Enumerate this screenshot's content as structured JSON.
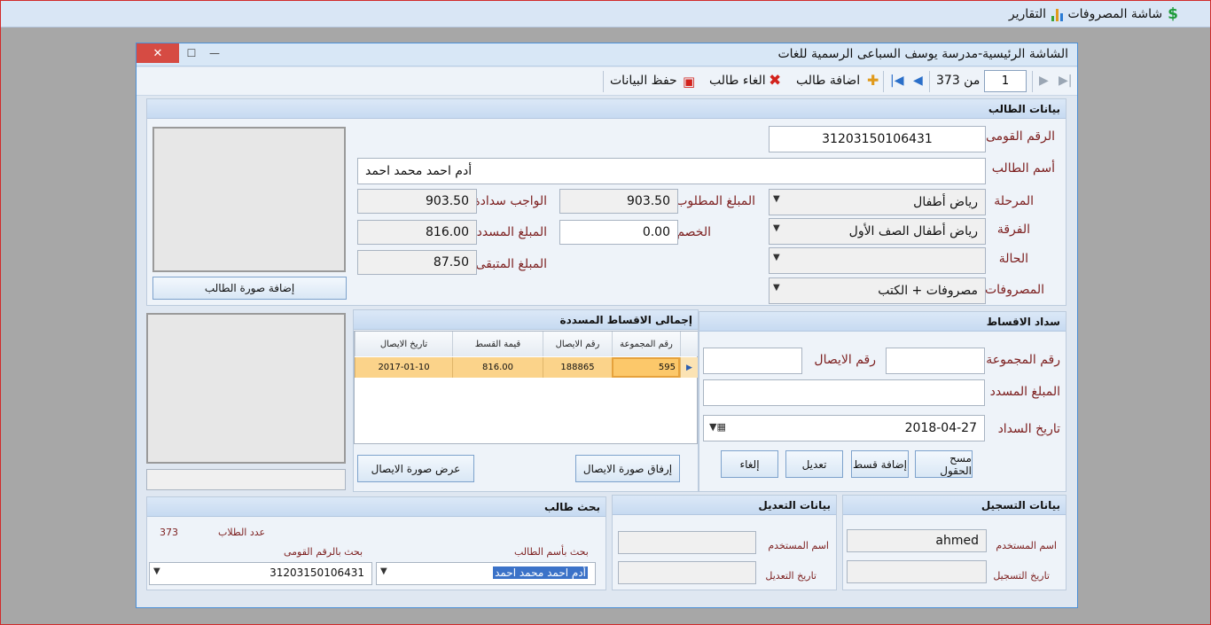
{
  "menubar": {
    "expenses_label": "شاشة المصروفات",
    "reports_label": "التقارير"
  },
  "window": {
    "title": "الشاشة الرئيسية-مدرسة يوسف السباعى الرسمية للغات",
    "close_glyph": "✕",
    "maximize_glyph": "☐",
    "minimize_glyph": "—"
  },
  "toolbar": {
    "page_value": "1",
    "of_total": "من 373",
    "add_student": "اضافة طالب",
    "cancel_student": "الغاء طالب",
    "save_data": "حفظ البيانات"
  },
  "student": {
    "header": "بيانات الطالب",
    "national_id_label": "الرقم القومى",
    "national_id": "31203150106431",
    "name_label": "أسم الطالب",
    "name": "أدم احمد محمد احمد",
    "stage_label": "المرحلة",
    "stage": "رياض أطفال",
    "class_label": "الفرقة",
    "class": "رياض أطفال الصف الأول",
    "status_label": "الحالة",
    "status": "",
    "expenses_label": "المصروفات",
    "expenses": "مصروفات + الكتب",
    "required_label": "المبلغ المطلوب",
    "required": "903.50",
    "due_label": "الواجب سدادة",
    "due": "903.50",
    "discount_label": "الخصم",
    "discount": "0.00",
    "paid_label": "المبلغ المسدد",
    "paid": "816.00",
    "remaining_label": "المبلغ المتبقى",
    "remaining": "87.50",
    "add_photo": "إضافة صورة الطالب"
  },
  "installments": {
    "header": "سداد الاقساط",
    "group_no_label": "رقم المجموعة",
    "group_no": "",
    "receipt_no_label": "رقم الايصال",
    "receipt_no": "",
    "amount_label": "المبلغ المسدد",
    "amount": "",
    "date_label": "تاريخ السداد",
    "date": "2018-04-27",
    "clear_btn": "مسح الحقول",
    "add_btn": "إضافة قسط",
    "edit_btn": "تعديل",
    "cancel_btn": "إلغاء"
  },
  "paid_total": {
    "header": "إجمالى الاقساط المسددة",
    "columns": [
      "رقم المجموعة",
      "رقم الايصال",
      "قيمة القسط",
      "تاريخ الايصال"
    ],
    "rows": [
      {
        "group": "595",
        "receipt": "188865",
        "value": "816.00",
        "date": "2017-01-10"
      }
    ],
    "attach_btn": "إرفاق صورة الايصال",
    "view_btn": "عرض صورة الايصال"
  },
  "registration": {
    "header": "بيانات التسجيل",
    "user_label": "اسم المستخدم",
    "user": "ahmed",
    "date_label": "تاريخ التسجيل",
    "date": ""
  },
  "modification": {
    "header": "بيانات التعديل",
    "user_label": "اسم المستخدم",
    "user": "",
    "date_label": "تاريخ التعديل",
    "date": ""
  },
  "search": {
    "header": "بحث طالب",
    "count_label": "عدد الطلاب",
    "count": "373",
    "by_name_label": "بحث بأسم الطالب",
    "by_name": "أدم احمد محمد احمد",
    "by_id_label": "بحث بالرقم القومى",
    "by_id": "31203150106431"
  },
  "colors": {
    "label": "#7d2020",
    "accent": "#4a8fd6",
    "selected_row": "#fbd38a",
    "close": "#d64b43"
  }
}
